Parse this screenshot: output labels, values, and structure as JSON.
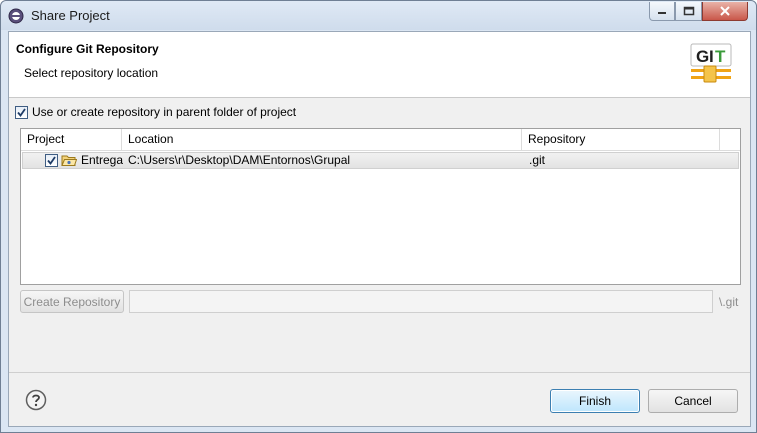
{
  "window": {
    "title": "Share Project"
  },
  "banner": {
    "title": "Configure Git Repository",
    "subtitle": "Select repository location",
    "logo_text": "GIT"
  },
  "options": {
    "use_parent_label": "Use or create repository in parent folder of project",
    "use_parent_checked": true
  },
  "table": {
    "columns": [
      "Project",
      "Location",
      "Repository"
    ],
    "rows": [
      {
        "checked": true,
        "project": "Entregal",
        "location": "C:\\Users\\r\\Desktop\\DAM\\Entornos\\Grupal",
        "repository": ".git"
      }
    ]
  },
  "create": {
    "button_label": "Create Repository",
    "path_value": "",
    "suffix": "\\.git"
  },
  "footer": {
    "finish_label": "Finish",
    "cancel_label": "Cancel"
  },
  "icons": {
    "app": "eclipse-icon",
    "help": "help-icon",
    "folder": "folder-icon",
    "logo": "git-logo-icon"
  },
  "colors": {
    "accent": "#3c7fb1",
    "close_button": "#c9574a",
    "git_logo_green": "#3a9b3a",
    "git_logo_orange": "#f0a416"
  }
}
